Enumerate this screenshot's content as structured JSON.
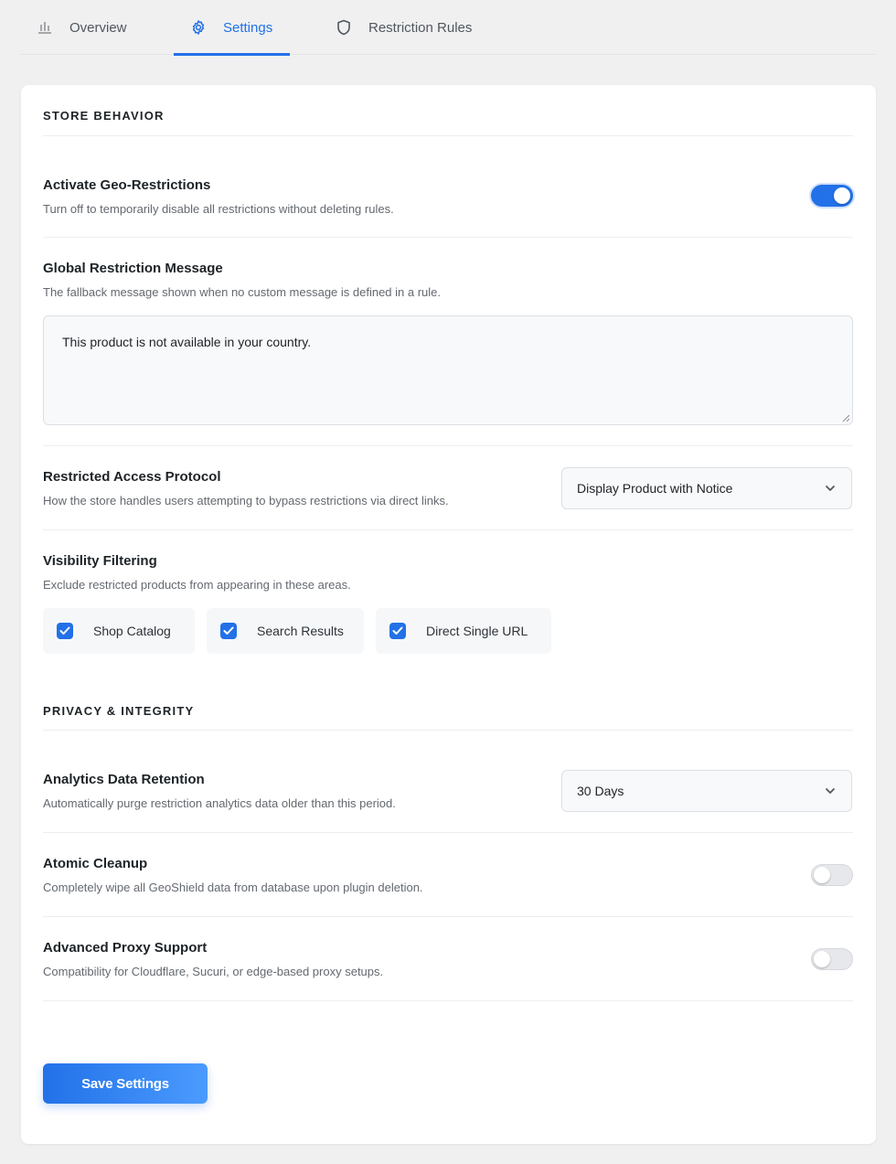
{
  "tabs": [
    {
      "label": "Overview",
      "icon": "bar-chart-icon",
      "active": false
    },
    {
      "label": "Settings",
      "icon": "gear-icon",
      "active": true
    },
    {
      "label": "Restriction Rules",
      "icon": "shield-icon",
      "active": false
    }
  ],
  "store_behavior": {
    "title": "STORE BEHAVIOR",
    "geo": {
      "title": "Activate Geo-Restrictions",
      "desc": "Turn off to temporarily disable all restrictions without deleting rules.",
      "enabled": true
    },
    "message": {
      "title": "Global Restriction Message",
      "desc": "The fallback message shown when no custom message is defined in a rule.",
      "value": "This product is not available in your country."
    },
    "protocol": {
      "title": "Restricted Access Protocol",
      "desc": "How the store handles users attempting to bypass restrictions via direct links.",
      "selected": "Display Product with Notice"
    },
    "visibility": {
      "title": "Visibility Filtering",
      "desc": "Exclude restricted products from appearing in these areas.",
      "options": [
        {
          "label": "Shop Catalog",
          "checked": true
        },
        {
          "label": "Search Results",
          "checked": true
        },
        {
          "label": "Direct Single URL",
          "checked": true
        }
      ]
    }
  },
  "privacy": {
    "title": "PRIVACY & INTEGRITY",
    "retention": {
      "title": "Analytics Data Retention",
      "desc": "Automatically purge restriction analytics data older than this period.",
      "selected": "30 Days"
    },
    "cleanup": {
      "title": "Atomic Cleanup",
      "desc": "Completely wipe all GeoShield data from database upon plugin deletion.",
      "enabled": false
    },
    "proxy": {
      "title": "Advanced Proxy Support",
      "desc": "Compatibility for Cloudflare, Sucuri, or edge-based proxy setups.",
      "enabled": false
    }
  },
  "save_label": "Save Settings",
  "colors": {
    "accent": "#2271e8",
    "background": "#f0f0f1",
    "card": "#ffffff"
  }
}
